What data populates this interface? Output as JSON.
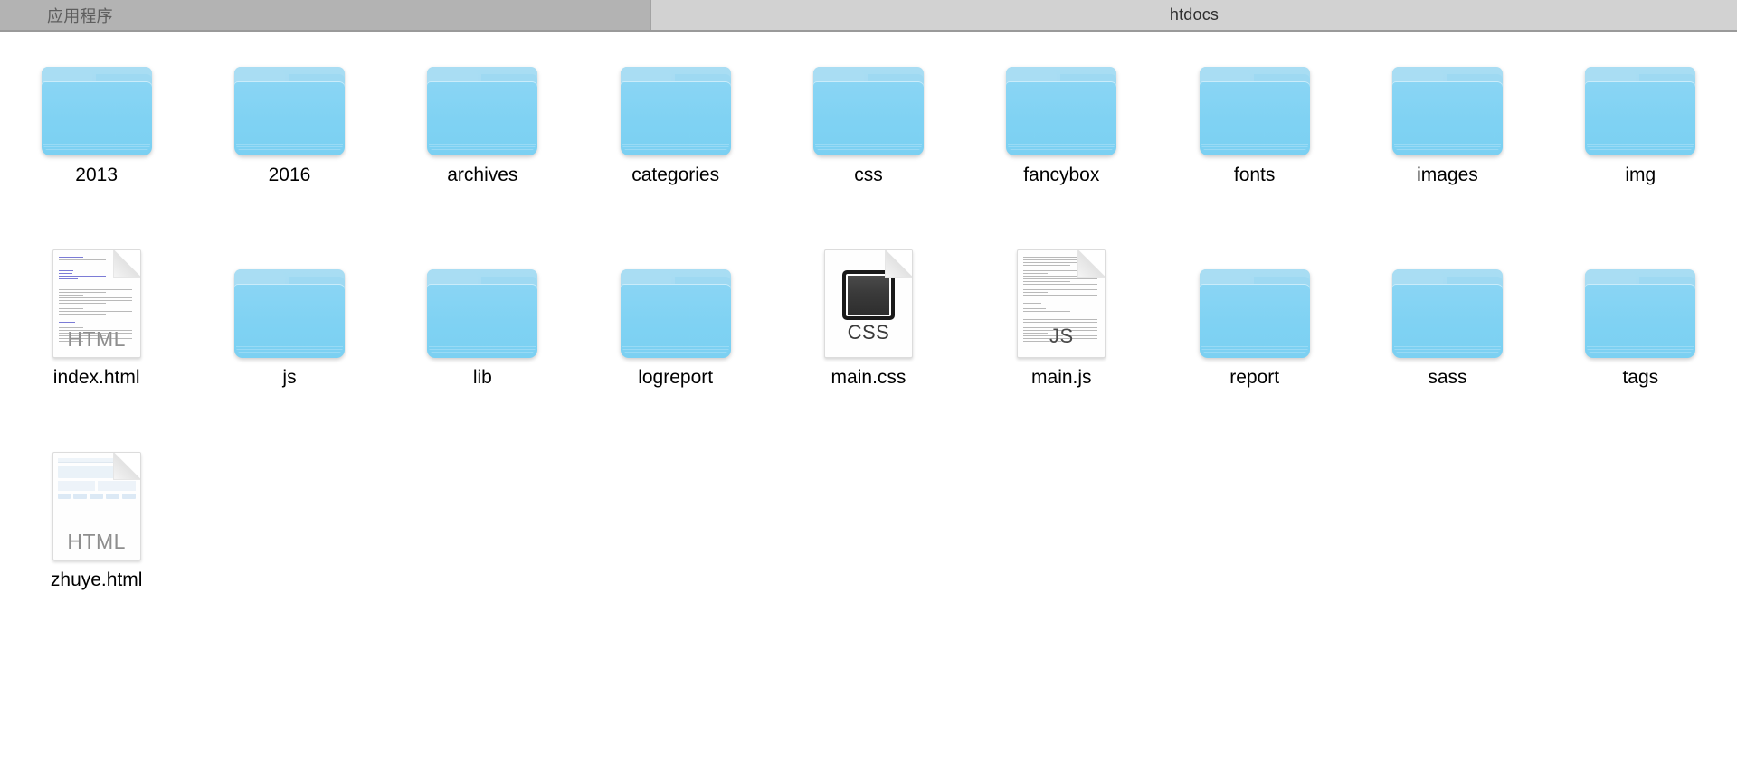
{
  "window": {
    "tabs": [
      {
        "label": "应用程序",
        "active": false,
        "name": "tab-applications"
      },
      {
        "label": "htdocs",
        "active": true,
        "name": "tab-htdocs"
      }
    ]
  },
  "colors": {
    "tab_inactive_bg": "#b3b3b3",
    "tab_active_bg": "#d2d2d2",
    "tab_border": "#9a9a9a",
    "folder_blue": "#7fd2f3",
    "folder_tab_blue": "#a9ddf3",
    "content_bg": "#ffffff",
    "label_text": "#010101"
  },
  "files": [
    {
      "name": "2013",
      "type": "folder"
    },
    {
      "name": "2016",
      "type": "folder"
    },
    {
      "name": "archives",
      "type": "folder"
    },
    {
      "name": "categories",
      "type": "folder"
    },
    {
      "name": "css",
      "type": "folder"
    },
    {
      "name": "fancybox",
      "type": "folder"
    },
    {
      "name": "fonts",
      "type": "folder"
    },
    {
      "name": "images",
      "type": "folder"
    },
    {
      "name": "img",
      "type": "folder"
    },
    {
      "name": "index.html",
      "type": "html-source",
      "badge": "HTML"
    },
    {
      "name": "js",
      "type": "folder"
    },
    {
      "name": "lib",
      "type": "folder"
    },
    {
      "name": "logreport",
      "type": "folder"
    },
    {
      "name": "main.css",
      "type": "css",
      "badge": "CSS"
    },
    {
      "name": "main.js",
      "type": "js",
      "badge": "JS"
    },
    {
      "name": "report",
      "type": "folder"
    },
    {
      "name": "sass",
      "type": "folder"
    },
    {
      "name": "tags",
      "type": "folder"
    },
    {
      "name": "zhuye.html",
      "type": "html-page",
      "badge": "HTML"
    }
  ],
  "layout": {
    "columns": 9,
    "rows": 3
  }
}
